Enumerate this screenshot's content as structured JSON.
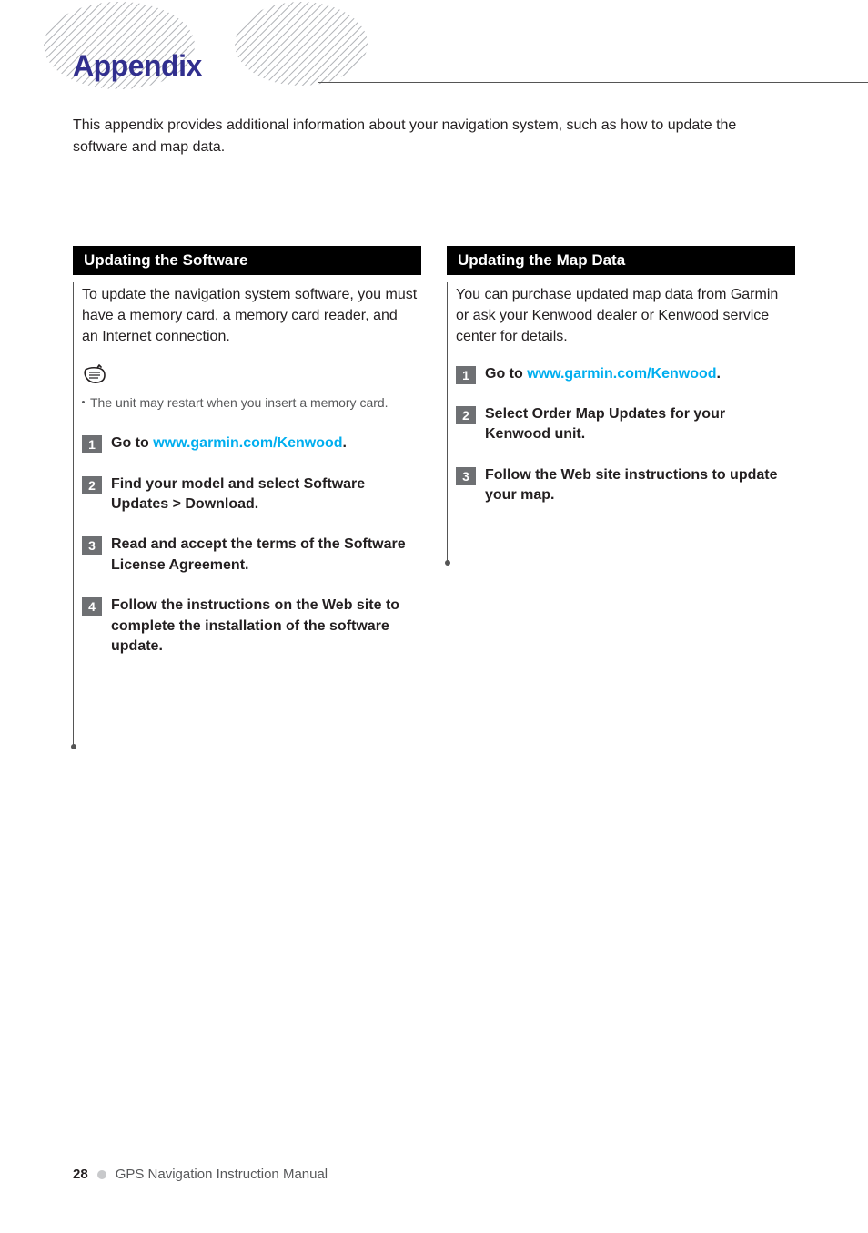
{
  "header": {
    "title": "Appendix"
  },
  "intro": "This appendix provides additional information about your navigation system, such as how to update the software and map data.",
  "left": {
    "heading": "Updating the Software",
    "intro": "To update the navigation system software, you must have a memory card, a memory card reader, and an Internet connection.",
    "note": "The unit may restart when you insert a memory card.",
    "steps": [
      {
        "num": "1",
        "prefix": "Go to ",
        "link": "www.garmin.com/Kenwood",
        "suffix": "."
      },
      {
        "num": "2",
        "text": "Find your model and select Software Updates > Download."
      },
      {
        "num": "3",
        "text": "Read and accept the terms of the Software License Agreement."
      },
      {
        "num": "4",
        "text": "Follow the instructions on the Web site to complete the installation of the software update."
      }
    ]
  },
  "right": {
    "heading": "Updating the Map Data",
    "intro": "You can purchase updated map data from Garmin or ask your Kenwood dealer or Kenwood service center for details.",
    "steps": [
      {
        "num": "1",
        "prefix": "Go to ",
        "link": "www.garmin.com/Kenwood",
        "suffix": "."
      },
      {
        "num": "2",
        "text": "Select Order Map Updates for your Kenwood unit."
      },
      {
        "num": "3",
        "text": "Follow the Web site instructions to update your map."
      }
    ]
  },
  "footer": {
    "page": "28",
    "title": "GPS Navigation Instruction Manual"
  }
}
